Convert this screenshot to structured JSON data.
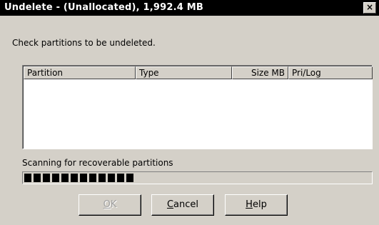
{
  "window": {
    "title": "Undelete -  (Unallocated),  1,992.4 MB",
    "close_glyph": "×"
  },
  "instruction": "Check partitions to be undeleted.",
  "partition_list": {
    "columns": [
      "Partition",
      "Type",
      "Size MB",
      "Pri/Log"
    ],
    "rows": []
  },
  "scan": {
    "label": "Scanning for recoverable partitions",
    "progress_fraction": 0.33
  },
  "buttons": {
    "ok": {
      "mnemonic": "O",
      "rest": "K",
      "enabled": false
    },
    "cancel": {
      "mnemonic": "C",
      "rest": "ancel",
      "enabled": true
    },
    "help": {
      "mnemonic": "H",
      "rest": "elp",
      "enabled": true
    }
  }
}
